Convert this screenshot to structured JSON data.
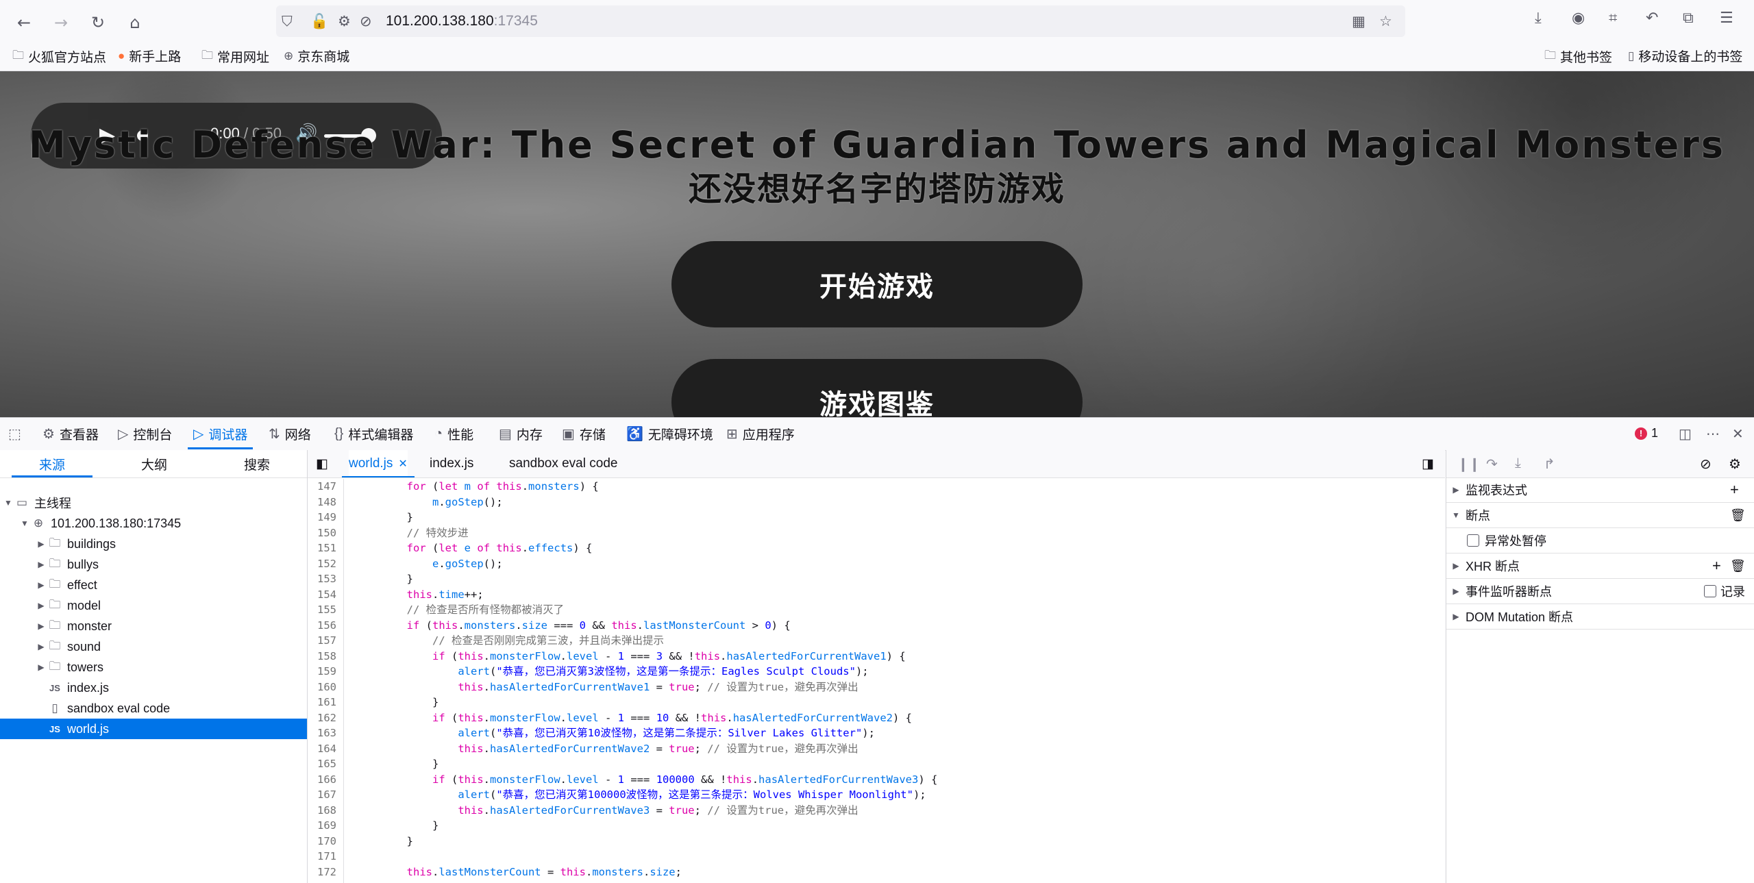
{
  "browser": {
    "url_host": "101.200.138.180",
    "url_port": ":17345",
    "bookmarks": [
      "火狐官方站点",
      "新手上路",
      "常用网址",
      "京东商城"
    ],
    "bookmarks_right": [
      "其他书签",
      "移动设备上的书签"
    ]
  },
  "game": {
    "audio_time": "0:00",
    "audio_duration": " / 0:50",
    "title": "Mystic Defense War: The Secret of Guardian Towers and Magical Monsters",
    "subtitle": "还没想好名字的塔防游戏",
    "buttons": [
      "开始游戏",
      "游戏图鉴"
    ]
  },
  "devtools": {
    "tabs": [
      "查看器",
      "控制台",
      "调试器",
      "网络",
      "样式编辑器",
      "性能",
      "内存",
      "存储",
      "无障碍环境",
      "应用程序"
    ],
    "active_tab": "调试器",
    "error_count": "1",
    "left_tabs": [
      "来源",
      "大纲",
      "搜索"
    ],
    "tree": {
      "thread": "主线程",
      "host": "101.200.138.180:17345",
      "folders": [
        "buildings",
        "bullys",
        "effect",
        "model",
        "monster",
        "sound",
        "towers"
      ],
      "files": [
        "index.js",
        "sandbox eval code",
        "world.js"
      ]
    },
    "editor_tabs": [
      "world.js",
      "index.js",
      "sandbox eval code"
    ],
    "code_lines": [
      {
        "n": "147",
        "html": "        <span class=\"k\">for</span> (<span class=\"k\">let</span> <span class=\"v\">m</span> <span class=\"k\">of</span> <span class=\"k\">this</span>.<span class=\"v\">monsters</span>) {"
      },
      {
        "n": "148",
        "html": "            <span class=\"v\">m</span>.<span class=\"v\">goStep</span>();"
      },
      {
        "n": "149",
        "html": "        }"
      },
      {
        "n": "150",
        "html": "        <span class=\"c\">// 特效步进</span>"
      },
      {
        "n": "151",
        "html": "        <span class=\"k\">for</span> (<span class=\"k\">let</span> <span class=\"v\">e</span> <span class=\"k\">of</span> <span class=\"k\">this</span>.<span class=\"v\">effects</span>) {"
      },
      {
        "n": "152",
        "html": "            <span class=\"v\">e</span>.<span class=\"v\">goStep</span>();"
      },
      {
        "n": "153",
        "html": "        }"
      },
      {
        "n": "154",
        "html": "        <span class=\"k\">this</span>.<span class=\"v\">time</span>++;"
      },
      {
        "n": "155",
        "html": "        <span class=\"c\">// 检查是否所有怪物都被消灭了</span>"
      },
      {
        "n": "156",
        "html": "        <span class=\"k\">if</span> (<span class=\"k\">this</span>.<span class=\"v\">monsters</span>.<span class=\"v\">size</span> === <span class=\"s\">0</span> &amp;&amp; <span class=\"k\">this</span>.<span class=\"v\">lastMonsterCount</span> &gt; <span class=\"s\">0</span>) {"
      },
      {
        "n": "157",
        "html": "            <span class=\"c\">// 检查是否刚刚完成第三波，并且尚未弹出提示</span>"
      },
      {
        "n": "158",
        "html": "            <span class=\"k\">if</span> (<span class=\"k\">this</span>.<span class=\"v\">monsterFlow</span>.<span class=\"v\">level</span> - <span class=\"s\">1</span> === <span class=\"s\">3</span> &amp;&amp; !<span class=\"k\">this</span>.<span class=\"v\">hasAlertedForCurrentWave1</span>) {"
      },
      {
        "n": "159",
        "html": "                <span class=\"v\">alert</span>(<span class=\"s\">\"恭喜，您已消灭第3波怪物，这是第一条提示：Eagles Sculpt Clouds\"</span>);"
      },
      {
        "n": "160",
        "html": "                <span class=\"k\">this</span>.<span class=\"v\">hasAlertedForCurrentWave1</span> = <span class=\"k\">true</span>; <span class=\"c\">// 设置为true，避免再次弹出</span>"
      },
      {
        "n": "161",
        "html": "            }"
      },
      {
        "n": "162",
        "html": "            <span class=\"k\">if</span> (<span class=\"k\">this</span>.<span class=\"v\">monsterFlow</span>.<span class=\"v\">level</span> - <span class=\"s\">1</span> === <span class=\"s\">10</span> &amp;&amp; !<span class=\"k\">this</span>.<span class=\"v\">hasAlertedForCurrentWave2</span>) {"
      },
      {
        "n": "163",
        "html": "                <span class=\"v\">alert</span>(<span class=\"s\">\"恭喜，您已消灭第10波怪物，这是第二条提示：Silver Lakes Glitter\"</span>);"
      },
      {
        "n": "164",
        "html": "                <span class=\"k\">this</span>.<span class=\"v\">hasAlertedForCurrentWave2</span> = <span class=\"k\">true</span>; <span class=\"c\">// 设置为true，避免再次弹出</span>"
      },
      {
        "n": "165",
        "html": "            }"
      },
      {
        "n": "166",
        "html": "            <span class=\"k\">if</span> (<span class=\"k\">this</span>.<span class=\"v\">monsterFlow</span>.<span class=\"v\">level</span> - <span class=\"s\">1</span> === <span class=\"s\">100000</span> &amp;&amp; !<span class=\"k\">this</span>.<span class=\"v\">hasAlertedForCurrentWave3</span>) {"
      },
      {
        "n": "167",
        "html": "                <span class=\"v\">alert</span>(<span class=\"s\">\"恭喜，您已消灭第100000波怪物，这是第三条提示：Wolves Whisper Moonlight\"</span>);"
      },
      {
        "n": "168",
        "html": "                <span class=\"k\">this</span>.<span class=\"v\">hasAlertedForCurrentWave3</span> = <span class=\"k\">true</span>; <span class=\"c\">// 设置为true，避免再次弹出</span>"
      },
      {
        "n": "169",
        "html": "            }"
      },
      {
        "n": "170",
        "html": "        }"
      },
      {
        "n": "171",
        "html": ""
      },
      {
        "n": "172",
        "html": "        <span class=\"k\">this</span>.<span class=\"v\">lastMonsterCount</span> = <span class=\"k\">this</span>.<span class=\"v\">monsters</span>.<span class=\"v\">size</span>;"
      }
    ],
    "right_pane": {
      "watch": "监视表达式",
      "breakpoints": "断点",
      "pause_on_exceptions": "异常处暂停",
      "xhr": "XHR 断点",
      "event_listeners": "事件监听器断点",
      "log": "记录",
      "dom_mutation": "DOM Mutation 断点"
    }
  }
}
